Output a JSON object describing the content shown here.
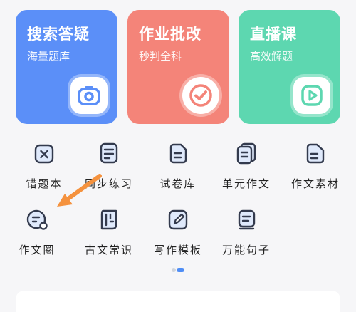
{
  "cards": [
    {
      "title": "搜索答疑",
      "subtitle": "海量题库",
      "icon": "camera-icon",
      "color": "#5b8ff8"
    },
    {
      "title": "作业批改",
      "subtitle": "秒判全科",
      "icon": "check-icon",
      "color": "#f48479"
    },
    {
      "title": "直播课",
      "subtitle": "高效解题",
      "icon": "play-icon",
      "color": "#5dd7b0"
    }
  ],
  "tools": [
    {
      "label": "错题本",
      "icon": "error-notebook-icon"
    },
    {
      "label": "同步练习",
      "icon": "sync-practice-icon"
    },
    {
      "label": "试卷库",
      "icon": "test-paper-icon"
    },
    {
      "label": "单元作文",
      "icon": "unit-essay-icon"
    },
    {
      "label": "作文素材",
      "icon": "essay-material-icon"
    },
    {
      "label": "作文圈",
      "icon": "essay-circle-icon"
    },
    {
      "label": "古文常识",
      "icon": "classical-chinese-icon"
    },
    {
      "label": "写作模板",
      "icon": "writing-template-icon"
    },
    {
      "label": "万能句子",
      "icon": "sentence-icon"
    }
  ],
  "pagination": {
    "active_color": "#4f8df5"
  },
  "annotation": {
    "arrow_color": "#f5923e"
  }
}
